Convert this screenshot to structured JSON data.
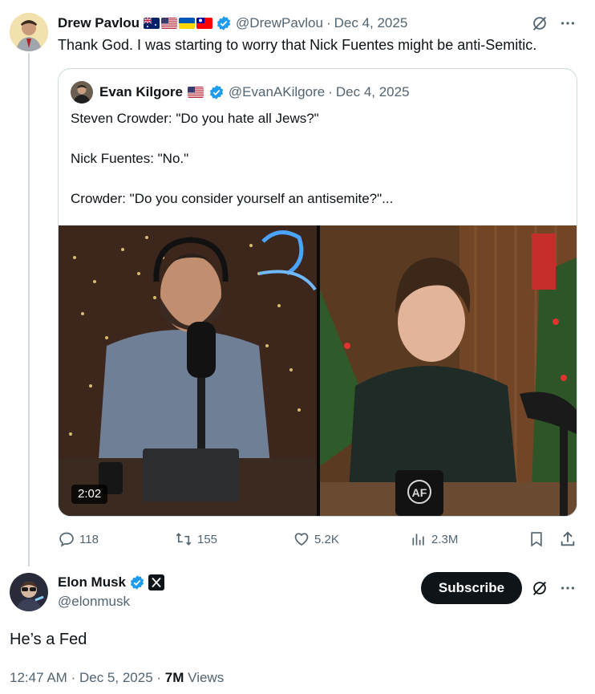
{
  "drew": {
    "name": "Drew Pavlou",
    "handle": "@DrewPavlou",
    "dot": "·",
    "date": "Dec 4, 2025",
    "text": "Thank God. I was starting to worry that Nick Fuentes might be anti-Semitic.",
    "flags": [
      "australia",
      "usa",
      "ukraine",
      "taiwan"
    ]
  },
  "quote": {
    "name": "Evan Kilgore",
    "handle": "@EvanAKilgore",
    "dot": "·",
    "date": "Dec 4, 2025",
    "line1": "Steven Crowder: \"Do you hate all Jews?\"",
    "line2": "Nick Fuentes: \"No.\"",
    "line3": "Crowder: \"Do you consider yourself an antisemite?\"...",
    "video_duration": "2:02",
    "mug_text": "AF"
  },
  "actions": {
    "replies": "118",
    "reposts": "155",
    "likes": "5.2K",
    "views": "2.3M"
  },
  "elon": {
    "name": "Elon Musk",
    "handle": "@elonmusk",
    "subscribe_label": "Subscribe",
    "text": "He’s a Fed",
    "time": "12:47 AM",
    "dot": "·",
    "date": "Dec 5, 2025",
    "views_count": "7M",
    "views_label": "Views"
  },
  "colors": {
    "verified": "#1d9bf0",
    "text_gray": "#536471",
    "border": "#cfd9de"
  }
}
